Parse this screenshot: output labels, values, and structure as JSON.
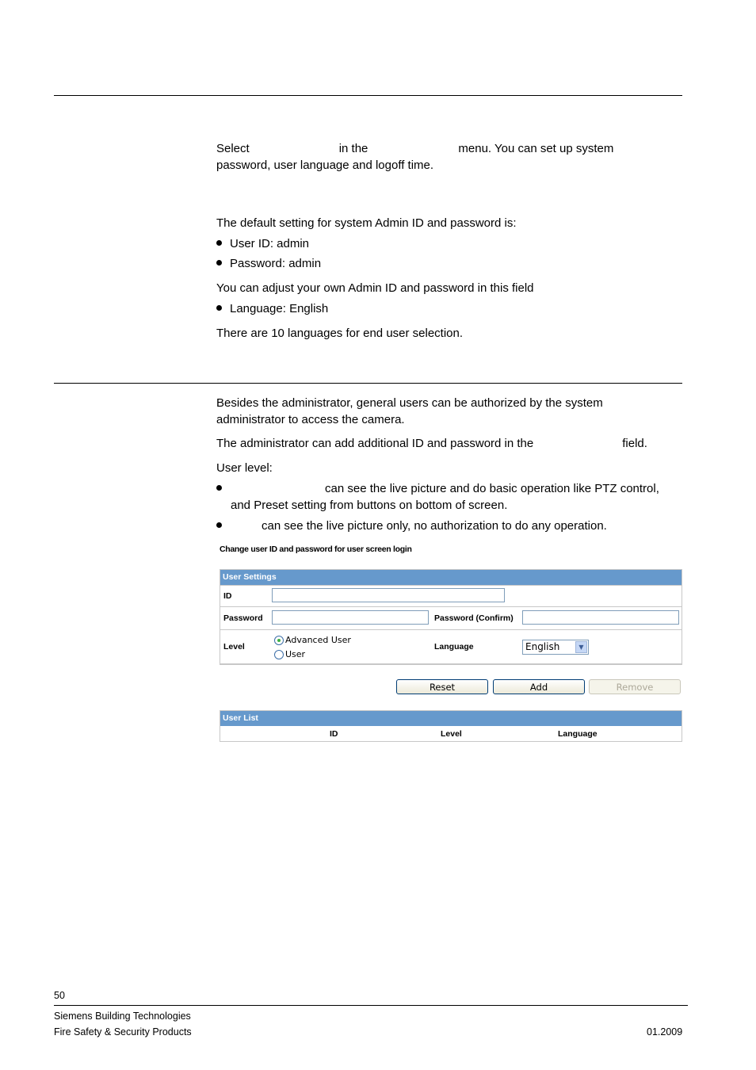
{
  "section1": {
    "intro_line1": {
      "select": "Select",
      "in_the": "in the",
      "menu_rest": "menu. You can set up system"
    },
    "intro_line2": "password, user language and logoff time.",
    "default_text": "The default setting for system Admin ID and password is:",
    "bullets": [
      "User ID: admin",
      "Password: admin"
    ],
    "adjust_text": "You can adjust your own Admin ID and password in this field",
    "language_bullet": "Language: English",
    "languages_text": "There are 10 languages for end user selection."
  },
  "section2": {
    "para1_line1": "Besides the administrator, general users can be authorized by the system",
    "para1_line2": "administrator to access the camera.",
    "para2_start": "The administrator can add additional ID and password in the",
    "para2_end": "field.",
    "user_level": "User level:",
    "level_bullet1_line1": "can see the live picture and do basic operation like PTZ control,",
    "level_bullet1_line2": "and Preset setting from buttons on bottom of screen.",
    "level_bullet2": "can see the live picture only, no authorization to do any operation."
  },
  "screenshot": {
    "caption": "Change user ID and password for user screen login",
    "user_settings": {
      "title": "User Settings",
      "id_label": "ID",
      "id_value": "",
      "password_label": "Password",
      "password_value": "",
      "password_confirm_label": "Password (Confirm)",
      "password_confirm_value": "",
      "level_label": "Level",
      "level_options": [
        "Advanced User",
        "User"
      ],
      "level_selected": "Advanced User",
      "language_label": "Language",
      "language_selected": "English"
    },
    "buttons": {
      "reset": "Reset",
      "add": "Add",
      "remove": "Remove"
    },
    "user_list": {
      "title": "User List",
      "columns": [
        "ID",
        "Level",
        "Language"
      ],
      "rows": []
    }
  },
  "footer": {
    "page_number": "50",
    "company": "Siemens Building Technologies",
    "division": "Fire Safety & Security Products",
    "date": "01.2009"
  },
  "colors": {
    "panel_header": "#6699cc",
    "radio_selected": "#3cb043"
  }
}
